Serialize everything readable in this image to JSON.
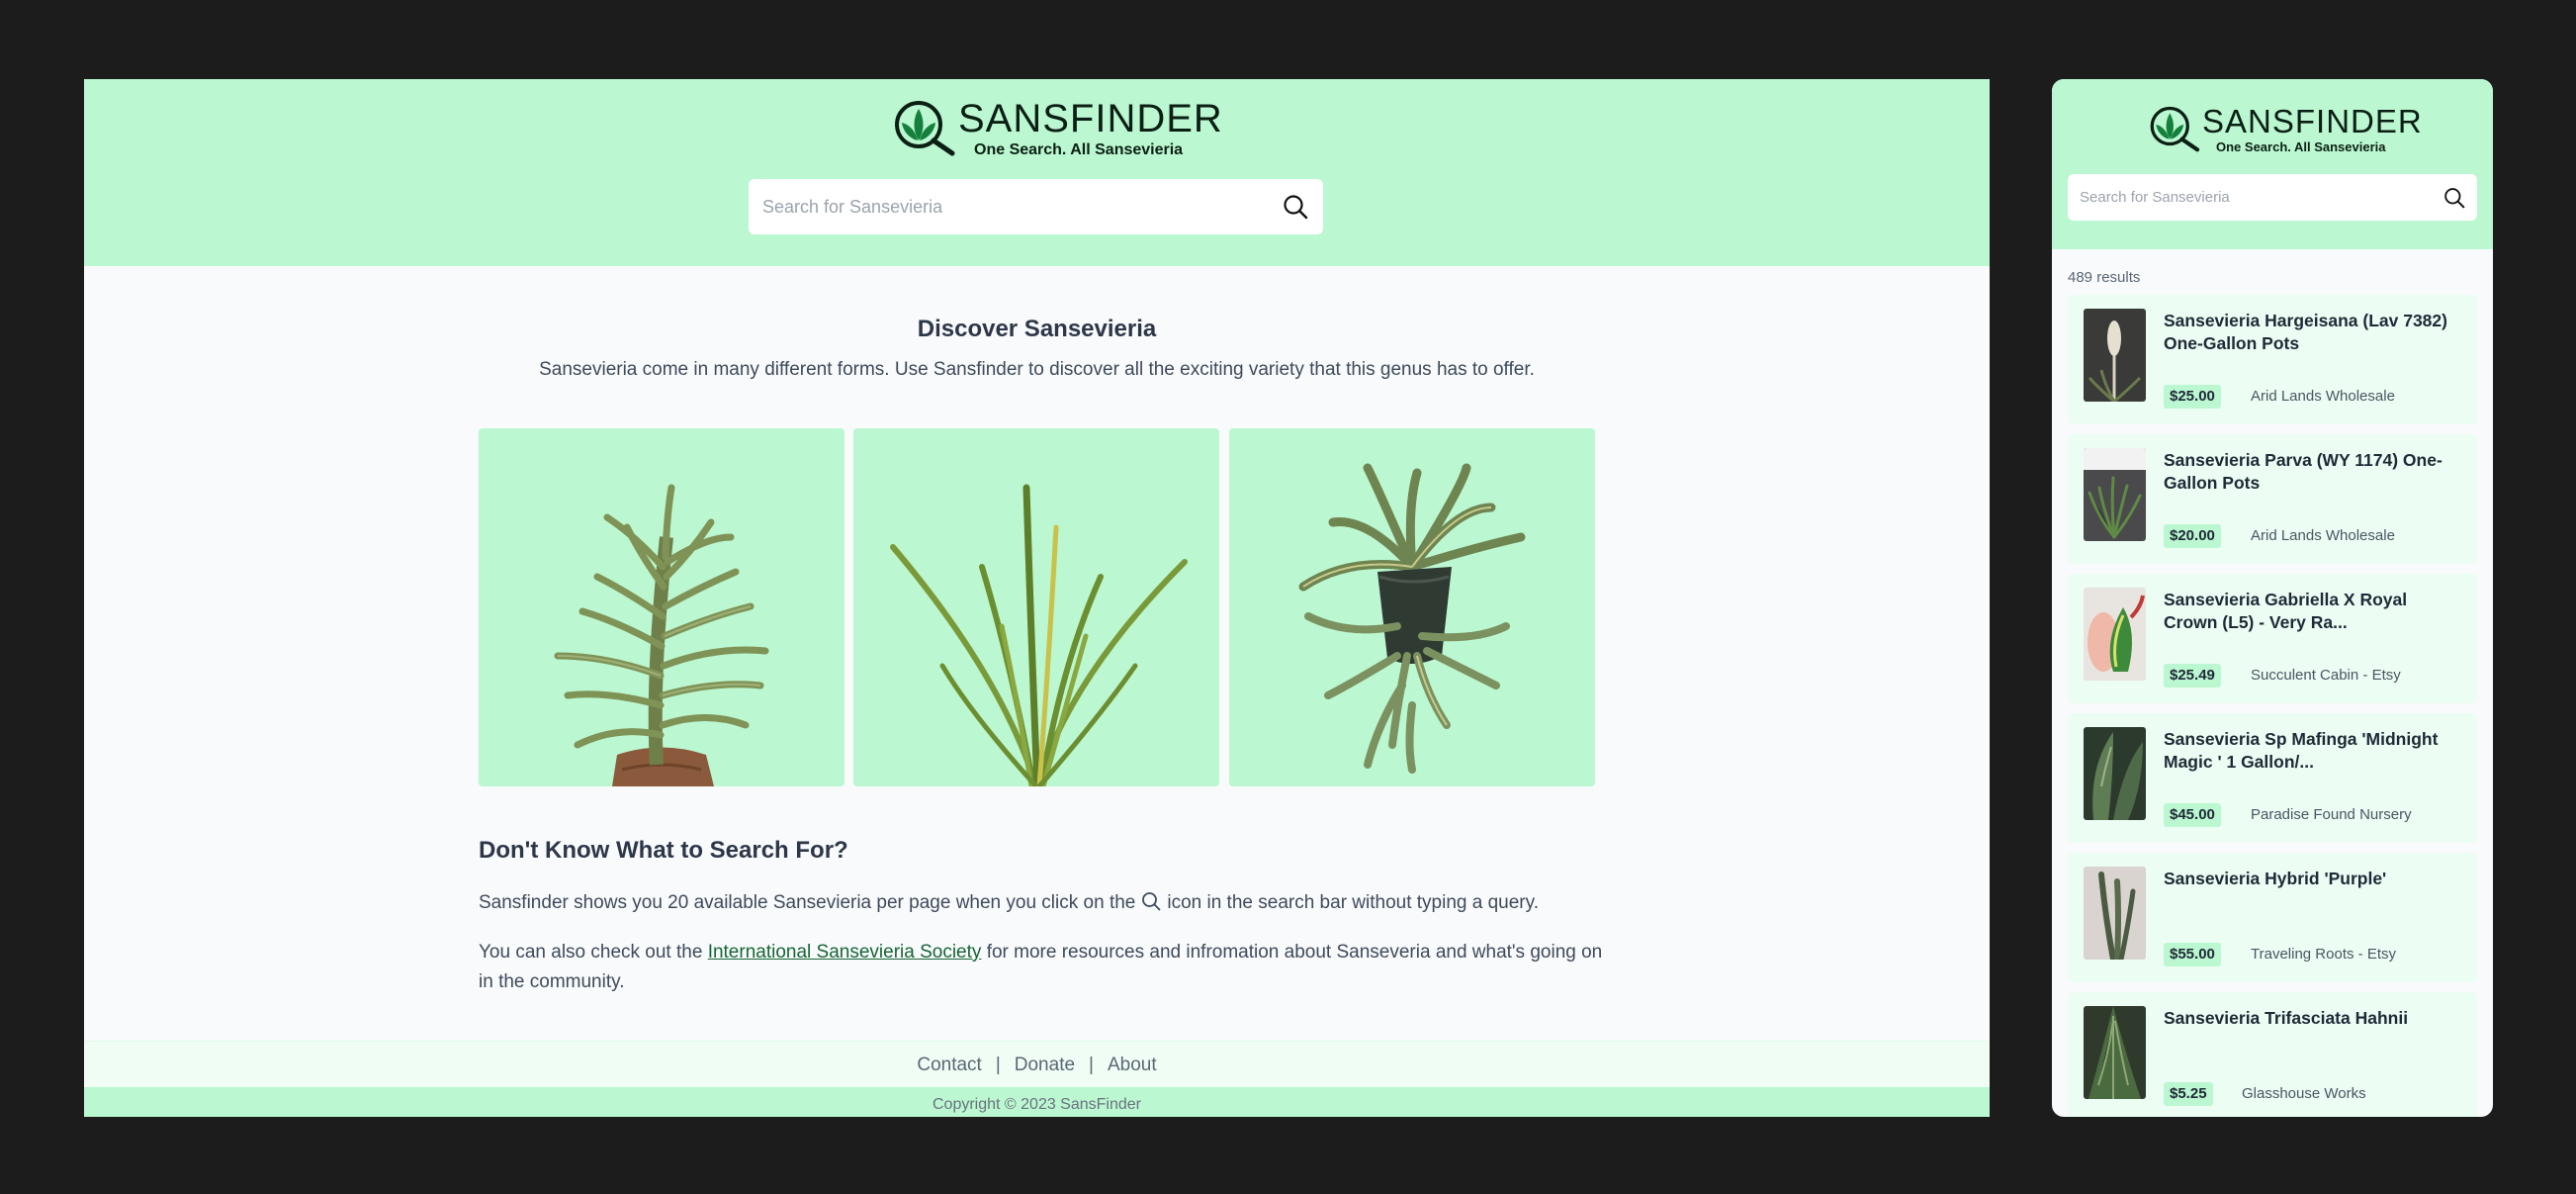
{
  "brand": {
    "title": "SANSFINDER",
    "tagline": "One Search. All Sansevieria"
  },
  "search": {
    "placeholder": "Search for Sansevieria"
  },
  "discover": {
    "title": "Discover Sansevieria",
    "subtitle": "Sansevieria come in many different forms. Use Sansfinder to discover all the exciting variety that this genus has to offer."
  },
  "dont_know": {
    "title": "Don't Know What to Search For?",
    "p1_before": "Sansfinder shows you 20 available Sansevieria per page when you click on the",
    "p1_after": "icon in the search bar without typing a query.",
    "p2_before": "You can also check out the",
    "p2_link": "International Sansevieria Society",
    "p2_after": "for more resources and infromation about Sanseveria and what's going on in the community."
  },
  "footer": {
    "links": [
      "Contact",
      "Donate",
      "About"
    ],
    "separator": "|",
    "copyright": "Copyright © 2023 SansFinder"
  },
  "results": {
    "count": "489 results",
    "items": [
      {
        "title": "Sansevieria Hargeisana (Lav 7382) One-Gallon Pots",
        "price": "$25.00",
        "seller": "Arid Lands Wholesale"
      },
      {
        "title": "Sansevieria Parva (WY 1174) One-Gallon Pots",
        "price": "$20.00",
        "seller": "Arid Lands Wholesale"
      },
      {
        "title": "Sansevieria Gabriella X Royal Crown (L5) - Very Ra...",
        "price": "$25.49",
        "seller": "Succulent Cabin - Etsy"
      },
      {
        "title": "Sansevieria Sp Mafinga 'Midnight Magic ' 1 Gallon/...",
        "price": "$45.00",
        "seller": "Paradise Found Nursery"
      },
      {
        "title": "Sansevieria Hybrid 'Purple'",
        "price": "$55.00",
        "seller": "Traveling Roots - Etsy"
      },
      {
        "title": "Sansevieria Trifasciata Hahnii",
        "price": "$5.25",
        "seller": "Glasshouse Works"
      }
    ]
  },
  "colors": {
    "accent": "#bbf7d0",
    "card": "#ecfdf3",
    "link": "#166534",
    "background": "#1c1c1c"
  }
}
